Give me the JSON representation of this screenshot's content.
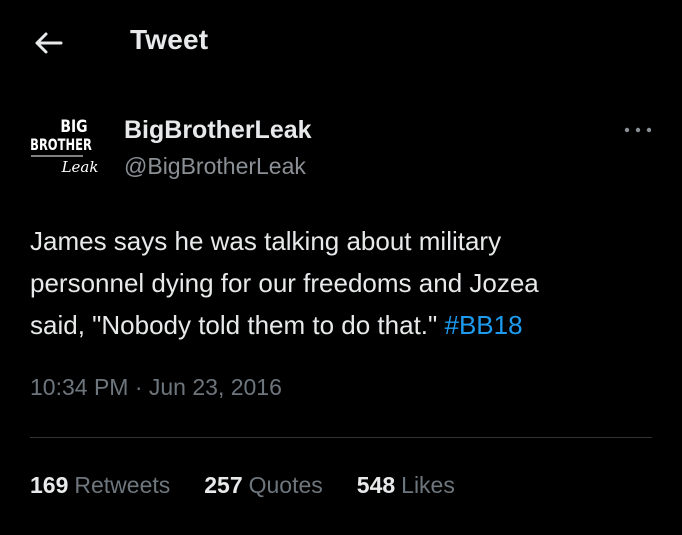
{
  "header": {
    "title": "Tweet",
    "back_icon": "arrow-left-icon"
  },
  "author": {
    "avatar_logo_text": "BIG BROTHER Leak",
    "display_name": "BigBrotherLeak",
    "handle": "@BigBrotherLeak",
    "more_icon": "more-horizontal-icon"
  },
  "tweet": {
    "line1": "James says he was talking about military",
    "line2": "personnel dying for our freedoms and Jozea",
    "line3": "said, \"Nobody told them to do that.\"",
    "hashtag": "#BB18",
    "timestamp": "10:34 PM · Jun 23, 2016"
  },
  "stats": {
    "retweets_count": "169",
    "retweets_label": "Retweets",
    "quotes_count": "257",
    "quotes_label": "Quotes",
    "likes_count": "548",
    "likes_label": "Likes"
  },
  "colors": {
    "background": "#000000",
    "text": "#e7e9ea",
    "secondary_text": "#6e767d",
    "link": "#1d9bf0",
    "divider": "#2f3336"
  }
}
